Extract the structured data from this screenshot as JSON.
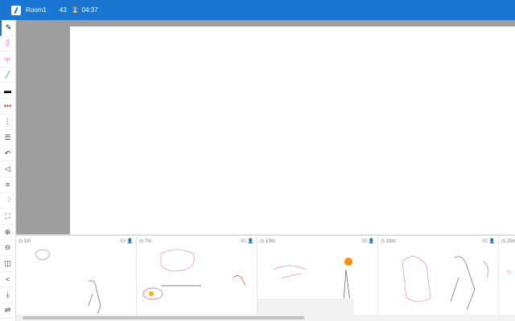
{
  "header": {
    "room": "Room1",
    "users": "43",
    "timer": "04:37"
  },
  "tools": [
    {
      "name": "pen-icon",
      "glyph": "✎",
      "color": "#000"
    },
    {
      "name": "eraser-icon",
      "glyph": "▯",
      "color": "#e040fb"
    },
    {
      "name": "marker-icon",
      "glyph": "╤",
      "color": "#ff8a9a"
    },
    {
      "name": "line-icon",
      "glyph": "╱",
      "color": "#1e88e5"
    },
    {
      "name": "image-icon",
      "glyph": "▬",
      "color": "#000"
    },
    {
      "name": "palette-icon",
      "glyph": "•••",
      "color": "#e53935"
    },
    {
      "name": "more-vert-icon",
      "glyph": "⋮",
      "color": "#444"
    },
    {
      "name": "layers-icon",
      "glyph": "☰",
      "color": "#444"
    },
    {
      "name": "undo-icon",
      "glyph": "↶",
      "color": "#444"
    },
    {
      "name": "back-icon",
      "glyph": "◁",
      "color": "#444"
    },
    {
      "name": "menu-icon",
      "glyph": "≡",
      "color": "#444"
    },
    {
      "name": "moon-icon",
      "glyph": "☽",
      "color": "#aaa"
    },
    {
      "name": "fit-screen-icon",
      "glyph": "⛶",
      "color": "#444"
    },
    {
      "name": "zoom-in-icon",
      "glyph": "⊕",
      "color": "#444"
    },
    {
      "name": "zoom-out-icon",
      "glyph": "⊖",
      "color": "#444"
    },
    {
      "name": "flip-icon",
      "glyph": "◫",
      "color": "#444"
    },
    {
      "name": "share-icon",
      "glyph": "<",
      "color": "#444"
    },
    {
      "name": "download-icon",
      "glyph": "⤓",
      "color": "#444"
    },
    {
      "name": "settings-icon",
      "glyph": "⇌",
      "color": "#444"
    }
  ],
  "thumbnails": [
    {
      "time": "1m",
      "count": "43"
    },
    {
      "time": "7m",
      "count": "40"
    },
    {
      "time": "13m",
      "count": "39"
    },
    {
      "time": "19m",
      "count": "40"
    },
    {
      "time": "25m",
      "count": ""
    }
  ]
}
